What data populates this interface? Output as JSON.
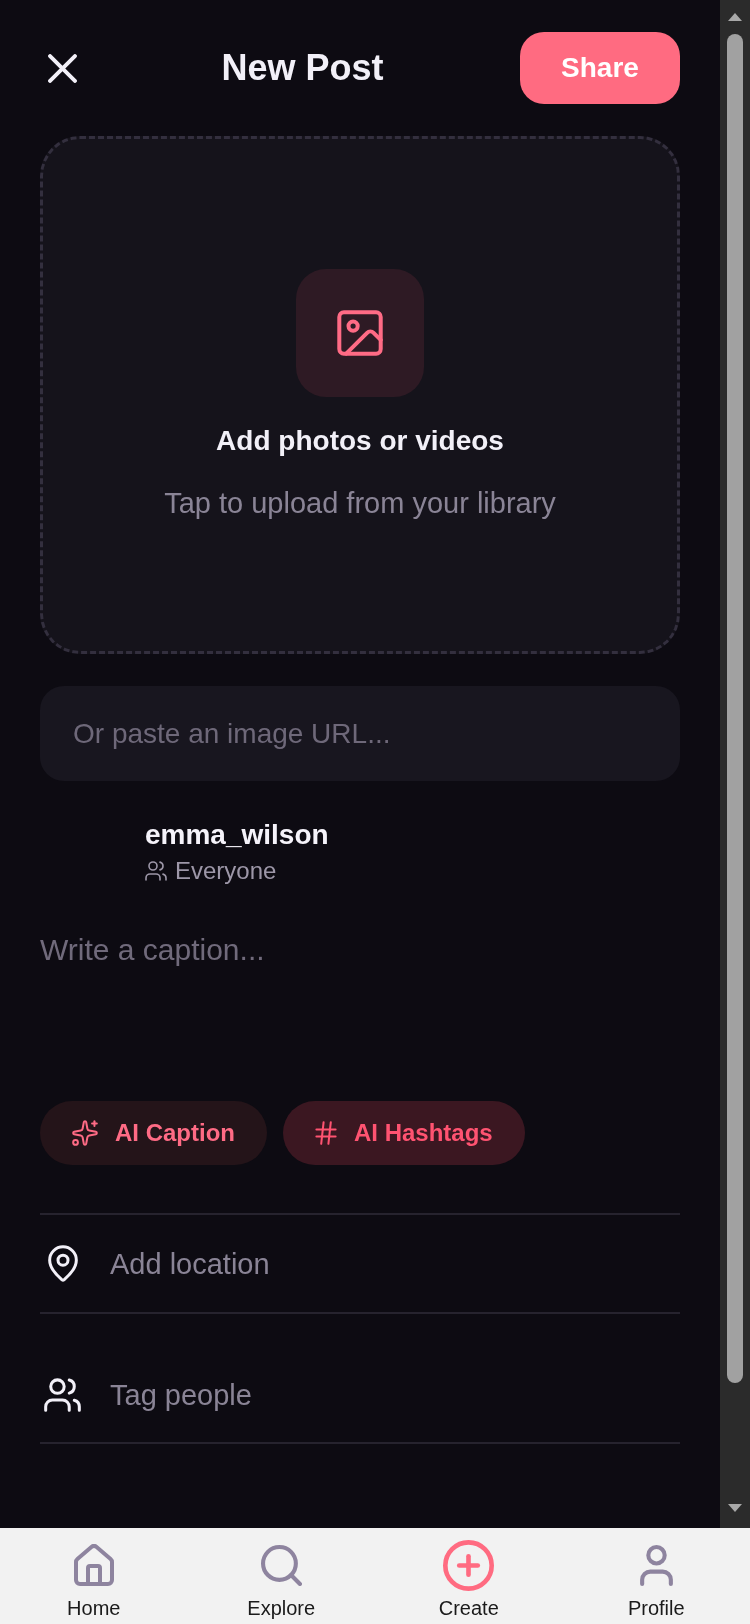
{
  "header": {
    "title": "New Post",
    "action": "Share"
  },
  "upload": {
    "title": "Add photos or videos",
    "subtitle": "Tap to upload from your library"
  },
  "url_field": {
    "placeholder": "Or paste an image URL..."
  },
  "author": {
    "username": "emma_wilson",
    "audience": "Everyone"
  },
  "caption": {
    "placeholder": "Write a caption..."
  },
  "ai_actions": [
    {
      "kind": "caption",
      "label": "AI Caption"
    },
    {
      "kind": "hashtags",
      "label": "AI Hashtags"
    }
  ],
  "options": [
    {
      "kind": "location",
      "label": "Add location"
    },
    {
      "kind": "people",
      "label": "Tag people"
    }
  ],
  "bottom_nav": [
    {
      "kind": "home",
      "label": "Home",
      "selected": false
    },
    {
      "kind": "explore",
      "label": "Explore",
      "selected": false
    },
    {
      "kind": "create",
      "label": "Create",
      "selected": true
    },
    {
      "kind": "profile",
      "label": "Profile",
      "selected": false
    }
  ]
}
